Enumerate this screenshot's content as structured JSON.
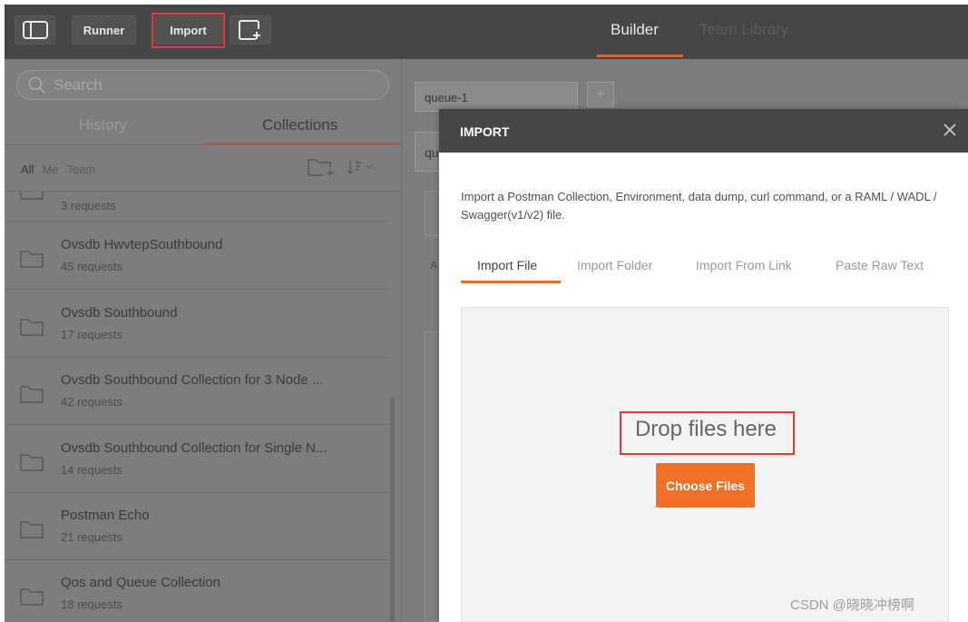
{
  "topbar": {
    "runner_label": "Runner",
    "import_label": "Import",
    "tabs": [
      {
        "label": "Builder"
      },
      {
        "label": "Team Library"
      }
    ]
  },
  "sidebar": {
    "search_placeholder": "Search",
    "tabs": [
      {
        "label": "History"
      },
      {
        "label": "Collections"
      }
    ],
    "filters": [
      "All",
      "Me",
      "Team"
    ],
    "collections": [
      {
        "name": "",
        "count": "3 requests"
      },
      {
        "name": "Ovsdb HwvtepSouthbound",
        "count": "45 requests"
      },
      {
        "name": "Ovsdb Southbound",
        "count": "17 requests"
      },
      {
        "name": "Ovsdb Southbound Collection for 3 Node ...",
        "count": "42 requests"
      },
      {
        "name": "Ovsdb Southbound Collection for Single N...",
        "count": "14 requests"
      },
      {
        "name": "Postman Echo",
        "count": "21 requests"
      },
      {
        "name": "Qos and Queue Collection",
        "count": "18 requests"
      }
    ]
  },
  "builder": {
    "request_tab": "queue-1",
    "add_tab": "+",
    "url_fragment": "qu",
    "side_letter": "A"
  },
  "modal": {
    "title": "IMPORT",
    "description": "Import a Postman Collection, Environment, data dump, curl command, or a RAML / WADL / Swagger(v1/v2) file.",
    "tabs": [
      {
        "label": "Import File",
        "active": true
      },
      {
        "label": "Import Folder"
      },
      {
        "label": "Import From Link"
      },
      {
        "label": "Paste Raw Text"
      }
    ],
    "drop_text": "Drop files here",
    "choose_button": "Choose Files"
  },
  "watermark": "CSDN @晓晓冲榜啊",
  "colors": {
    "accent": "#f07026",
    "highlight": "#e53935",
    "header": "#464646"
  }
}
